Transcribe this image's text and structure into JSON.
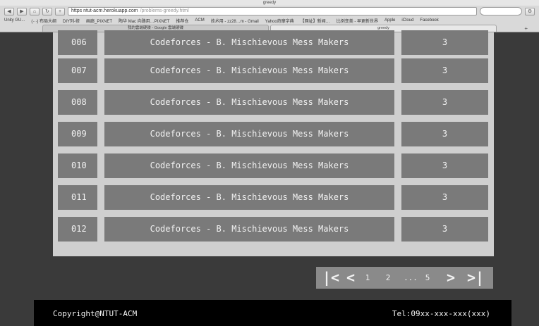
{
  "browser": {
    "window_title": "greedy",
    "url_host": "https ntut-acm.herokuapp.com",
    "url_path": "/problems-greedy.html",
    "bookmarks": [
      "Unity GU...",
      "(···) 布局大纲",
      "DIY列-修",
      "画廊_PIXNET",
      "陶华 Mac 向路用…PIXNET",
      "推荐仓",
      "ACM",
      "技术用 - zz28…m - Gmail",
      "Yahoo奇摩字典",
      "【网址】新闻…",
      "比例变美 - 早更新世界",
      "Apple",
      "iCloud",
      "Facebook"
    ],
    "tabs": [
      "我的雲端硬碟 - Google 雲端硬碟",
      "greedy"
    ]
  },
  "problems": [
    {
      "id": "006",
      "title": "Codeforces - B. Mischievous Mess Makers",
      "score": "3"
    },
    {
      "id": "007",
      "title": "Codeforces - B. Mischievous Mess Makers",
      "score": "3"
    },
    {
      "id": "008",
      "title": "Codeforces - B. Mischievous Mess Makers",
      "score": "3"
    },
    {
      "id": "009",
      "title": "Codeforces - B. Mischievous Mess Makers",
      "score": "3"
    },
    {
      "id": "010",
      "title": "Codeforces - B. Mischievous Mess Makers",
      "score": "3"
    },
    {
      "id": "011",
      "title": "Codeforces - B. Mischievous Mess Makers",
      "score": "3"
    },
    {
      "id": "012",
      "title": "Codeforces - B. Mischievous Mess Makers",
      "score": "3"
    }
  ],
  "pagination": {
    "first_icon": "first-page-icon",
    "prev_icon": "prev-page-icon",
    "pages": [
      "1",
      "2"
    ],
    "ellipsis": "...",
    "last_page": "5",
    "next_icon": "next-page-icon",
    "last_icon": "last-page-icon"
  },
  "footer": {
    "copyright": "Copyright@NTUT-ACM",
    "tel": "Tel:09xx-xxx-xxx(xxx)"
  },
  "colors": {
    "page_bg": "#3a3a3a",
    "panel_bg": "#cfcfcf",
    "cell_bg": "#7a7a7a",
    "pager_bg": "#8a8a8a",
    "footer_bg": "#000000"
  }
}
